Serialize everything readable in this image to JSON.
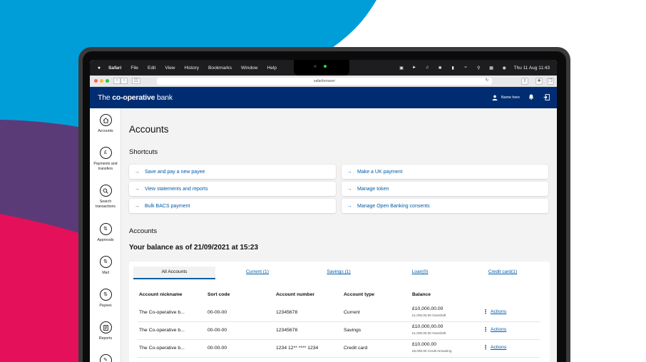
{
  "colors": {
    "brand_navy": "#002d72",
    "link_blue": "#005aa8",
    "bg_blue": "#009ed9",
    "bg_purple": "#5a3b78",
    "bg_pink": "#e4105a"
  },
  "menubar": {
    "app": "Safari",
    "items": [
      "File",
      "Edit",
      "View",
      "History",
      "Bookmarks",
      "Window",
      "Help"
    ],
    "clock": "Thu 11 Aug  11:43"
  },
  "browser": {
    "url": "safaribrowser"
  },
  "bank": {
    "logo_prefix": "The",
    "logo_bold": "co-operative",
    "logo_suffix": "bank",
    "user_name": "Name here"
  },
  "sidebar": {
    "items": [
      {
        "label": "Accounts",
        "icon": "home-icon"
      },
      {
        "label": "Payments and transfers",
        "icon": "pound-icon"
      },
      {
        "label": "Search transactions",
        "icon": "search-icon"
      },
      {
        "label": "Approvals",
        "icon": "approvals-icon"
      },
      {
        "label": "Mail",
        "icon": "mail-icon"
      },
      {
        "label": "Payees",
        "icon": "payees-icon"
      },
      {
        "label": "Reports",
        "icon": "reports-icon"
      }
    ]
  },
  "page": {
    "title": "Accounts",
    "shortcuts_heading": "Shortcuts",
    "shortcuts": [
      "Save and pay a new payee",
      "Make a UK payment",
      "View statements and reports",
      "Manage token",
      "Bulk BACS payment",
      "Manage Open Banking consents"
    ],
    "accounts_heading": "Accounts",
    "balance_heading": "Your balance as of 21/09/2021 at 15:23"
  },
  "tabs": [
    "All Accounts",
    "Current (1)",
    "Savings (1)",
    "Loan(0)",
    "Credit card(1)"
  ],
  "table": {
    "headers": [
      "Account nickname",
      "Sort code",
      "Account number",
      "Account type",
      "Balance"
    ],
    "action_label": "Actions",
    "rows": [
      {
        "nickname": "The Co-operative b...",
        "sort": "00-00-00",
        "number": "12345678",
        "type": "Current",
        "balance": "£10,000,00.00",
        "sub": "£1,000,00.00 Overdraft"
      },
      {
        "nickname": "The Co-operative b...",
        "sort": "00-00-00",
        "number": "12345678",
        "type": "Savings",
        "balance": "£10,000,00.00",
        "sub": "£1,000,00.00 Overdraft"
      },
      {
        "nickname": "The Co-operative b...",
        "sort": "00-00-00",
        "number": "1234 12** **** 1234",
        "type": "Credit card",
        "balance": "£10,000.00",
        "sub": "£5,000.00 Credit remaining"
      }
    ]
  }
}
